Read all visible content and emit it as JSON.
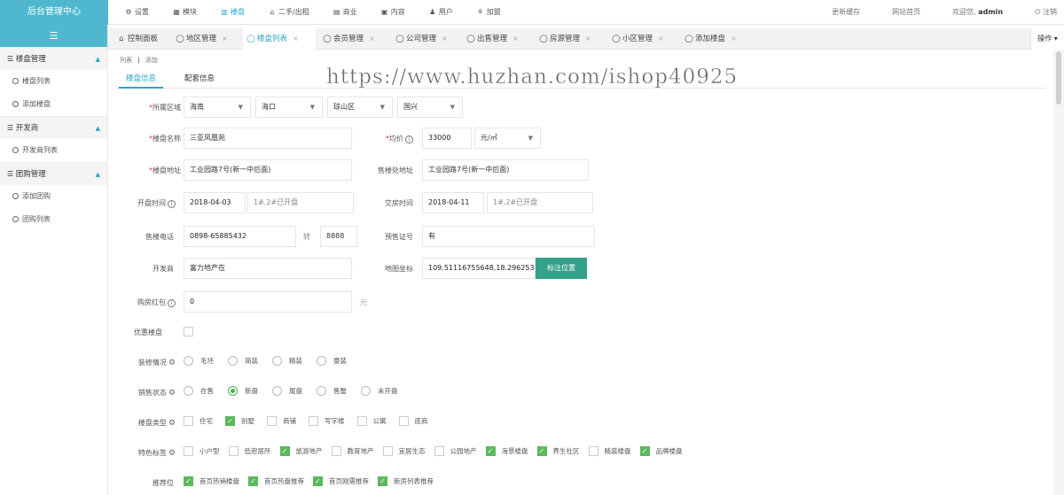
{
  "app_title": "后台管理中心",
  "topnav": [
    {
      "icon": "gear-icon",
      "glyph": "⚙",
      "label": "设置",
      "active": false
    },
    {
      "icon": "module-icon",
      "glyph": "▦",
      "label": "模块",
      "active": false
    },
    {
      "icon": "building-icon",
      "glyph": "▥",
      "label": "楼盘",
      "active": true
    },
    {
      "icon": "house-icon",
      "glyph": "⌂",
      "label": "二手/出租",
      "active": false
    },
    {
      "icon": "shop-icon",
      "glyph": "▤",
      "label": "商业",
      "active": false
    },
    {
      "icon": "content-icon",
      "glyph": "▣",
      "label": "内容",
      "active": false
    },
    {
      "icon": "user-icon",
      "glyph": "♟",
      "label": "用户",
      "active": false
    },
    {
      "icon": "alliance-icon",
      "glyph": "⚘",
      "label": "加盟",
      "active": false
    }
  ],
  "topright": {
    "clear_cache": "更新缓存",
    "site_home": "网站首页",
    "welcome": "欢迎您,",
    "username": "admin",
    "logout": "注销"
  },
  "sidebar": {
    "toggle_glyph": "☰",
    "groups": [
      {
        "label": "楼盘管理",
        "items": [
          "楼盘列表",
          "添加楼盘"
        ]
      },
      {
        "label": "开发商",
        "items": [
          "开发商列表"
        ]
      },
      {
        "label": "团购管理",
        "items": [
          "添加团购",
          "团购列表"
        ]
      }
    ]
  },
  "tabs": [
    "控制面板",
    "地区管理",
    "楼盘列表",
    "会员管理",
    "公司管理",
    "出售管理",
    "房源管理",
    "小区管理",
    "添加楼盘"
  ],
  "tab_close": "×",
  "operate_label": "操作",
  "breadcrumb": {
    "list": "列表",
    "sep": "|",
    "add": "添加"
  },
  "subtabs": [
    "楼盘信息",
    "配套信息"
  ],
  "watermark": "https://www.huzhan.com/ishop40925",
  "form": {
    "region_label": "所属区域",
    "region_values": [
      "海南",
      "海口",
      "琼山区",
      "国兴"
    ],
    "name_label": "楼盘名称",
    "name_value": "三亚凤凰苑",
    "price_label": "均价",
    "price_value": "33000",
    "price_unit": "元/㎡",
    "address_label": "楼盘地址",
    "address_value": "工业园路7号(新一中后面)",
    "sales_address_label": "售楼处地址",
    "sales_address_value": "工业园路7号(新一中后面)",
    "open_label": "开盘时间",
    "open_date": "2018-04-03",
    "open_note": "1#,2#已开盘",
    "delivery_label": "交房时间",
    "delivery_date": "2018-04-11",
    "delivery_note": "1#,2#已开盘",
    "phone_label": "售楼电话",
    "phone_value": "0898-65885432",
    "ext_label": "转",
    "ext_value": "8888",
    "presale_label": "预售证号",
    "presale_value": "有",
    "developer_label": "开发商",
    "developer_value": "富力地产在",
    "coord_label": "地图坐标",
    "coord_value": "109.51116755648,18.2962530",
    "coord_button": "标注位置",
    "redpack_label": "购房红包",
    "redpack_value": "0",
    "redpack_unit": "元",
    "discount_label": "优惠楼盘",
    "decoration_label": "装修情况",
    "decoration_options": [
      {
        "label": "毛坯",
        "checked": false
      },
      {
        "label": "简装",
        "checked": false
      },
      {
        "label": "精装",
        "checked": false
      },
      {
        "label": "豪装",
        "checked": false
      }
    ],
    "sale_status_label": "销售状态",
    "sale_status_options": [
      {
        "label": "在售",
        "checked": false
      },
      {
        "label": "新盘",
        "checked": true
      },
      {
        "label": "尾盘",
        "checked": false
      },
      {
        "label": "售罄",
        "checked": false
      },
      {
        "label": "未开盘",
        "checked": false
      }
    ],
    "type_label": "楼盘类型",
    "type_options": [
      {
        "label": "住宅",
        "checked": false
      },
      {
        "label": "别墅",
        "checked": true
      },
      {
        "label": "商铺",
        "checked": false
      },
      {
        "label": "写字楼",
        "checked": false
      },
      {
        "label": "公寓",
        "checked": false
      },
      {
        "label": "底商",
        "checked": false
      }
    ],
    "feature_label": "特色标签",
    "feature_options": [
      {
        "label": "小户型",
        "checked": false
      },
      {
        "label": "低密居所",
        "checked": false
      },
      {
        "label": "旅游地产",
        "checked": true
      },
      {
        "label": "教育地产",
        "checked": false
      },
      {
        "label": "宜居生态",
        "checked": false
      },
      {
        "label": "公园地产",
        "checked": false
      },
      {
        "label": "海景楼盘",
        "checked": true
      },
      {
        "label": "养生社区",
        "checked": true
      },
      {
        "label": "精装楼盘",
        "checked": false
      },
      {
        "label": "品牌楼盘",
        "checked": true
      }
    ],
    "recommend_label": "推荐位",
    "recommend_options": [
      {
        "label": "首页热销楼盘",
        "checked": true
      },
      {
        "label": "首页热盘推荐",
        "checked": true
      },
      {
        "label": "首页刚需推荐",
        "checked": true
      },
      {
        "label": "新房列表推荐",
        "checked": true
      }
    ]
  },
  "colors": {
    "accent": "#4fb8cf",
    "active_text": "#2aa5c8",
    "button": "#34a18a",
    "check": "#5cb85c",
    "required": "#e53935"
  }
}
